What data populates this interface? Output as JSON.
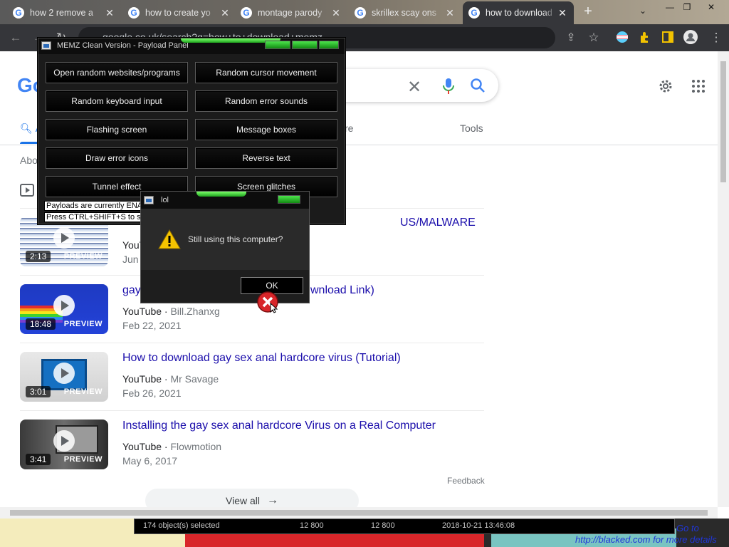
{
  "browser": {
    "tabs": [
      {
        "label": "how 2 remove a",
        "close": "✕",
        "active": false
      },
      {
        "label": "how to create yo",
        "close": "✕",
        "active": false
      },
      {
        "label": "montage parody",
        "close": "✕",
        "active": false
      },
      {
        "label": "skrillex scay ons",
        "close": "✕",
        "active": false
      },
      {
        "label": "how to download",
        "close": "✕",
        "active": true
      }
    ],
    "new_tab": "+",
    "url": "google.co.uk/search?q=how+to+download+memz"
  },
  "google": {
    "logo": "Go",
    "active_tab": "A",
    "more_tab": "re",
    "tools_tab": "Tools",
    "about": "Abo",
    "results": [
      {
        "title": "",
        "title_tail": "US/MALWARE",
        "source": "YouTube",
        "channel": "",
        "date": "Jun",
        "duration": "2:13",
        "preview": "PREVIEW"
      },
      {
        "title": "gay",
        "title_tail": "wnload Link)",
        "source": "YouTube",
        "channel": "Bill.Zhanxg",
        "date": "Feb 22, 2021",
        "duration": "18:48",
        "preview": "PREVIEW"
      },
      {
        "title": "How to download gay sex anal hardcore virus (Tutorial)",
        "source": "YouTube",
        "channel": "Mr Savage",
        "date": "Feb 26, 2021",
        "duration": "3:01",
        "preview": "PREVIEW"
      },
      {
        "title": "Installing the gay sex anal hardcore Virus on a Real Computer",
        "source": "YouTube",
        "channel": "Flowmotion",
        "date": "May 6, 2017",
        "duration": "3:41",
        "preview": "PREVIEW"
      }
    ],
    "feedback": "Feedback",
    "view_all": "View all",
    "view_all_arrow": "→"
  },
  "memz": {
    "title": "MEMZ Clean Version - Payload Panel",
    "buttons": [
      "Open random websites/programs",
      "Random cursor movement",
      "Random keyboard input",
      "Random error sounds",
      "Flashing screen",
      "Message boxes",
      "Draw error icons",
      "Reverse text",
      "Tunnel effect",
      "Screen glitches"
    ],
    "status1": "Payloads are currently ENAB",
    "status2": "Press CTRL+SHIFT+S to sk"
  },
  "dialog": {
    "title": "lol",
    "message": "Still using this computer?",
    "ok": "OK"
  },
  "desktop": {
    "status_selected": "174 object(s) selected",
    "size1": "12 800",
    "size2": "12 800",
    "timestamp": "2018-10-21 13:46:08",
    "ad_link": "http://blacked.com for more details",
    "goto": "Go to"
  },
  "colors": {
    "link": "#1a0dab",
    "google_blue": "#1a73e8",
    "memz_glow": "#3fd63f"
  }
}
